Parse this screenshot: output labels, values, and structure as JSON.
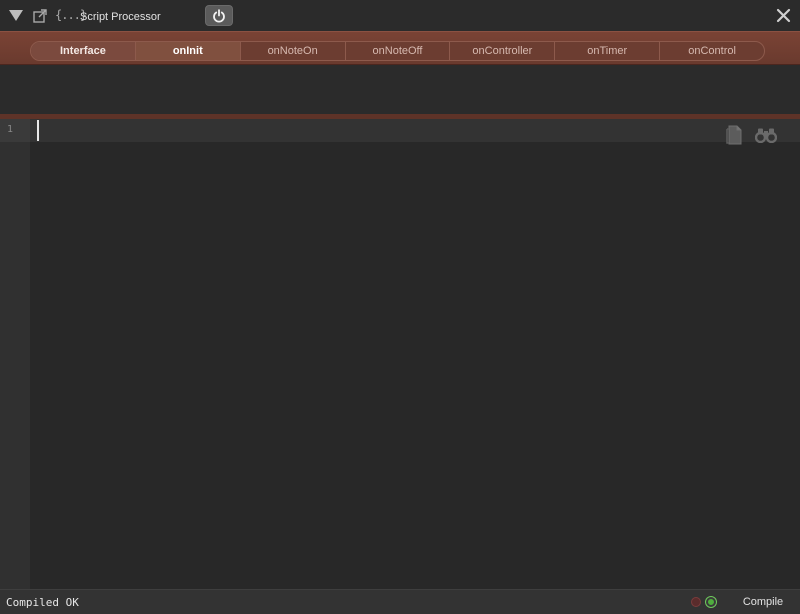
{
  "window": {
    "title": "Script Processor",
    "icons": {
      "collapse": "collapse-triangle-icon",
      "popout": "external-link-icon",
      "braces": "curly-braces-icon",
      "power": "power-icon",
      "close": "close-icon"
    },
    "braces_glyph": "{...}"
  },
  "callbacks": {
    "tabs": [
      {
        "label": "Interface",
        "state": "interface"
      },
      {
        "label": "onInit",
        "state": "active"
      },
      {
        "label": "onNoteOn",
        "state": "normal"
      },
      {
        "label": "onNoteOff",
        "state": "normal"
      },
      {
        "label": "onController",
        "state": "normal"
      },
      {
        "label": "onTimer",
        "state": "normal"
      },
      {
        "label": "onControl",
        "state": "normal"
      }
    ],
    "accent_color": "#7a4335"
  },
  "editor": {
    "line_numbers": [
      "1"
    ],
    "content": "",
    "icons": {
      "document": "document-icon",
      "find": "binoculars-icon"
    }
  },
  "status": {
    "message": "Compiled OK",
    "compile_label": "Compile",
    "indicators": {
      "error": {
        "icon": "red-led-icon",
        "color": "#7b3c3c",
        "on": false
      },
      "ok": {
        "icon": "green-led-icon",
        "color": "#4fae3e",
        "on": true
      }
    }
  }
}
